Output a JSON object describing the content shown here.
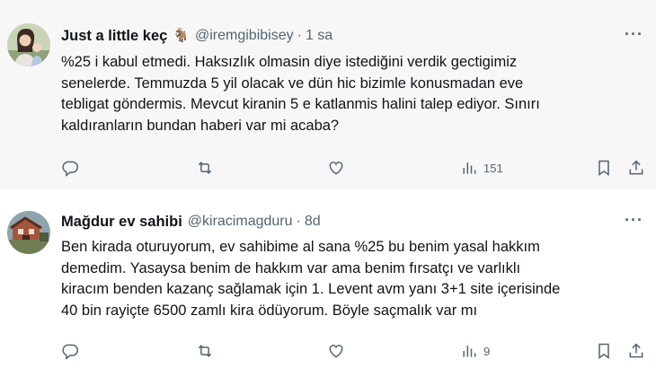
{
  "tweets": [
    {
      "name": "Just a little keç",
      "emoji": "🐐",
      "handle": "@iremgibibisey",
      "separator": "·",
      "time": "1 sa",
      "more_label": "···",
      "text_lines": [
        "%25 i kabul etmedi. Haksızlık olmasin diye istediğini verdik gectigimiz",
        "senelerde. Temmuzda 5 yil olacak ve dün hic bizimle konusmadan eve",
        "tebligat göndermis. Mevcut kiranin 5 e katlanmis halini talep ediyor. Sınırı",
        "kaldıranların bundan haberi var mi acaba?"
      ],
      "views": "151",
      "icons": {
        "reply": "reply-icon",
        "retweet": "retweet-icon",
        "like": "like-icon",
        "views": "views-icon",
        "bookmark": "bookmark-icon",
        "share": "share-icon"
      }
    },
    {
      "name": "Mağdur ev sahibi",
      "emoji": "",
      "handle": "@kiracimagduru",
      "separator": "·",
      "time": "8d",
      "more_label": "···",
      "text_lines": [
        "Ben kirada oturuyorum, ev sahibime al sana %25 bu benim yasal hakkım",
        "demedim. Yasaysa benim de hakkım var ama benim fırsatçı ve varlıklı",
        "kiracım benden kazanç sağlamak için 1. Levent avm yanı 3+1 site içerisinde",
        "40 bin rayiçte 6500 zamlı kira ödüyorum. Böyle saçmalık var mı"
      ],
      "views": "9",
      "icons": {
        "reply": "reply-icon",
        "retweet": "retweet-icon",
        "like": "like-icon",
        "views": "views-icon",
        "bookmark": "bookmark-icon",
        "share": "share-icon"
      }
    }
  ],
  "colors": {
    "text": "#0f1419",
    "muted": "#536471",
    "tweet1_bg": "#f7f7f7"
  }
}
